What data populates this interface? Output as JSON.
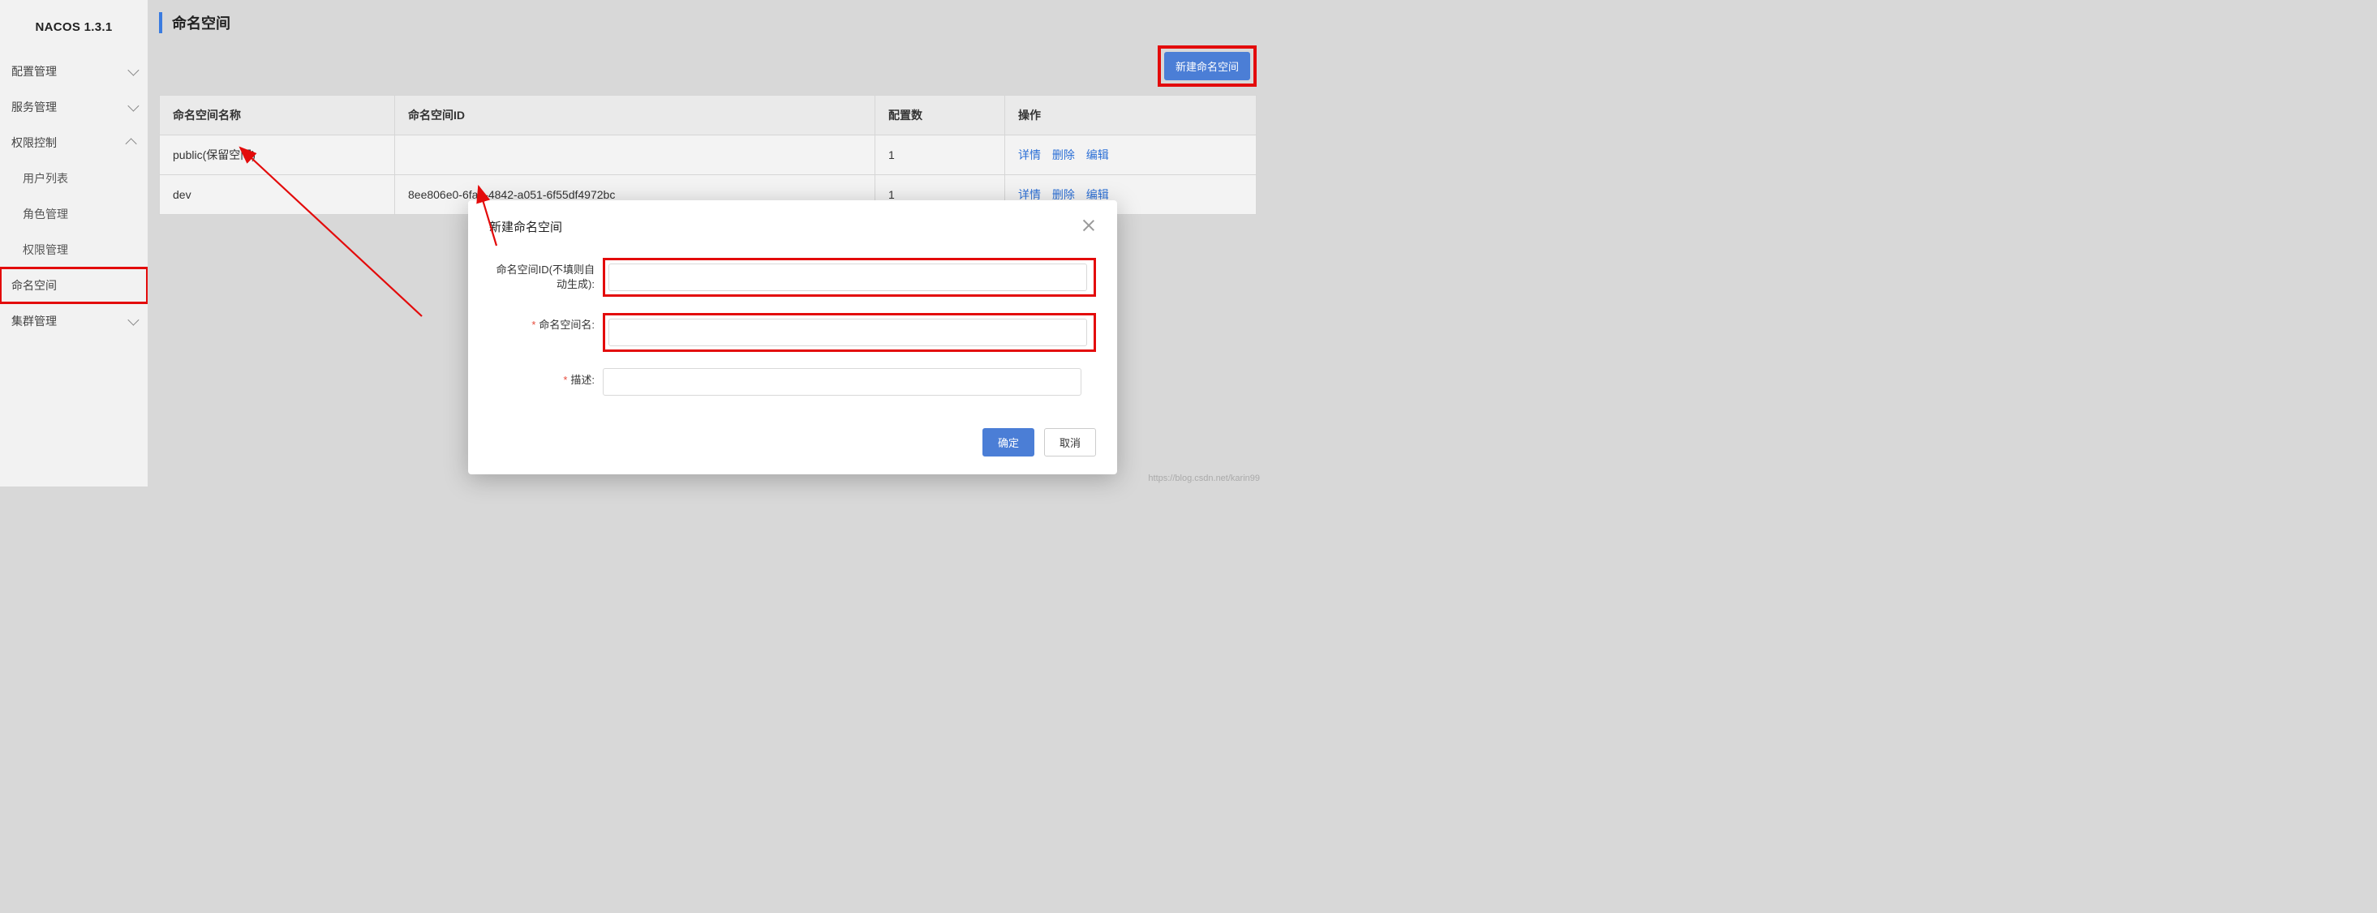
{
  "app": {
    "title": "NACOS 1.3.1"
  },
  "sidebar": {
    "items": [
      {
        "label": "配置管理",
        "expanded": false
      },
      {
        "label": "服务管理",
        "expanded": false
      },
      {
        "label": "权限控制",
        "expanded": true
      },
      {
        "label": "用户列表"
      },
      {
        "label": "角色管理"
      },
      {
        "label": "权限管理"
      },
      {
        "label": "命名空间"
      },
      {
        "label": "集群管理",
        "expanded": false
      }
    ]
  },
  "page": {
    "title": "命名空间",
    "create_label": "新建命名空间"
  },
  "table": {
    "headers": [
      "命名空间名称",
      "命名空间ID",
      "配置数",
      "操作"
    ],
    "rows": [
      {
        "name": "public(保留空间)",
        "id": "",
        "count": "1"
      },
      {
        "name": "dev",
        "id": "8ee806e0-6fa8-4842-a051-6f55df4972bc",
        "count": "1"
      }
    ],
    "ops": {
      "detail": "详情",
      "delete": "删除",
      "edit": "编辑"
    }
  },
  "modal": {
    "title": "新建命名空间",
    "fields": {
      "ns_id": "命名空间ID(不填则自动生成):",
      "ns_name": "命名空间名:",
      "desc": "描述:"
    },
    "ok": "确定",
    "cancel": "取消"
  },
  "watermark": "https://blog.csdn.net/karin99"
}
